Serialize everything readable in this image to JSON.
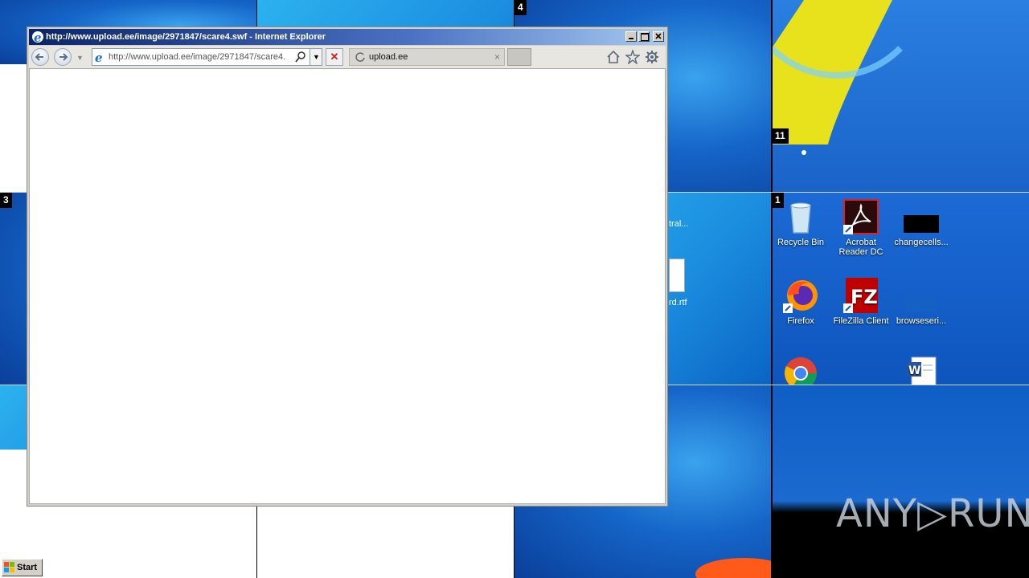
{
  "browser": {
    "title": "http://www.upload.ee/image/2971847/scare4.swf - Internet Explorer",
    "address_url": "http://www.upload.ee/image/2971847/scare4.",
    "tab_label": "upload.ee",
    "tab_close": "×",
    "stop_glyph": "✕"
  },
  "tiles": {
    "tile4": "4",
    "tile11": "11",
    "tile3": "3",
    "tile1": "1"
  },
  "desktop": {
    "partial_label_1": "tral...",
    "partial_label_2": "rd.rtf",
    "icons": [
      {
        "label": "Recycle Bin",
        "icon": "recycle-bin-icon"
      },
      {
        "label": "Acrobat Reader DC",
        "icon": "acrobat-icon"
      },
      {
        "label": "changecells...",
        "icon": "black-file-icon"
      },
      {
        "label": "Firefox",
        "icon": "firefox-icon"
      },
      {
        "label": "FileZilla Client",
        "icon": "filezilla-icon"
      },
      {
        "label": "browseseri...",
        "icon": "blank-file-icon"
      },
      {
        "label": "",
        "icon": "chrome-icon"
      },
      {
        "label": "",
        "icon": "word-doc-icon"
      }
    ]
  },
  "taskbar": {
    "start_label": "Start"
  },
  "watermark": "ANY▷RUN"
}
